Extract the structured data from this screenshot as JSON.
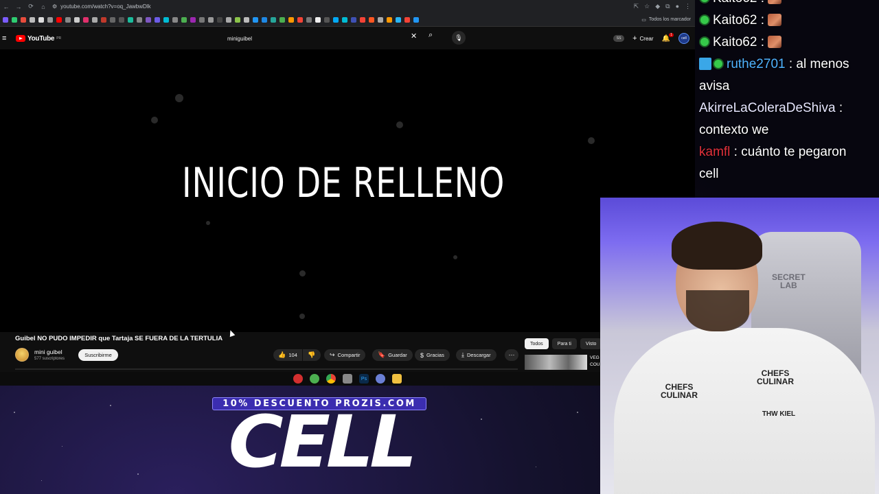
{
  "browser": {
    "url": "youtube.com/watch?v=oq_JawbwDlk",
    "bookmarks_folder_label": "Todos los marcador"
  },
  "youtube": {
    "logo_text": "YouTube",
    "logo_country": "PR",
    "search_value": "miniguibel",
    "badge_ss": "SS",
    "create_label": "Crear",
    "notification_count": "1",
    "account_initials": "cell"
  },
  "player": {
    "overlay_text": "INICIO DE RELLENO"
  },
  "video": {
    "title": "Guibel NO PUDO IMPEDIR que Tartaja SE FUERA DE LA TERTULIA",
    "channel_name": "mini guibel",
    "subscribers": "577 suscriptores",
    "subscribe_label": "Suscribirme",
    "like_count": "104",
    "share_label": "Compartir",
    "save_label": "Guardar",
    "thanks_label": "Gracias",
    "download_label": "Descargar"
  },
  "filters": {
    "all": "Todos",
    "for_you": "Para ti",
    "watched": "Visto"
  },
  "recommendation": {
    "title_fragment_1": "VEG",
    "title_fragment_2": "COU"
  },
  "chat": {
    "messages": [
      {
        "user": "Kaito62",
        "sep": " : "
      },
      {
        "user": "Kaito62",
        "sep": " : "
      },
      {
        "user": "Kaito62",
        "sep": " : "
      },
      {
        "user": "ruthe2701",
        "sep": " : ",
        "text_1": "al menos",
        "text_2": "avisa",
        "user_color": "#4fb3ff"
      },
      {
        "user": "AkirreLaColeraDeShiva",
        "sep": " :",
        "text": "contexto we",
        "user_color": "#e6e6ff"
      },
      {
        "user": "kamfl",
        "sep": " : ",
        "text_1": "cuánto te pegaron",
        "text_2": "cell",
        "user_color": "#e0303a"
      }
    ]
  },
  "webcam": {
    "chair_brand_1": "SECRET",
    "chair_brand_2": "LAB",
    "jersey_sponsor_left": "CHEFS CULINAR",
    "jersey_sponsor_right": "CHEFS CULINAR",
    "jersey_team": "THW KIEL"
  },
  "banner": {
    "promo_text": "10% DESCUENTO PROZIS.COM",
    "code_text": "CELL"
  }
}
